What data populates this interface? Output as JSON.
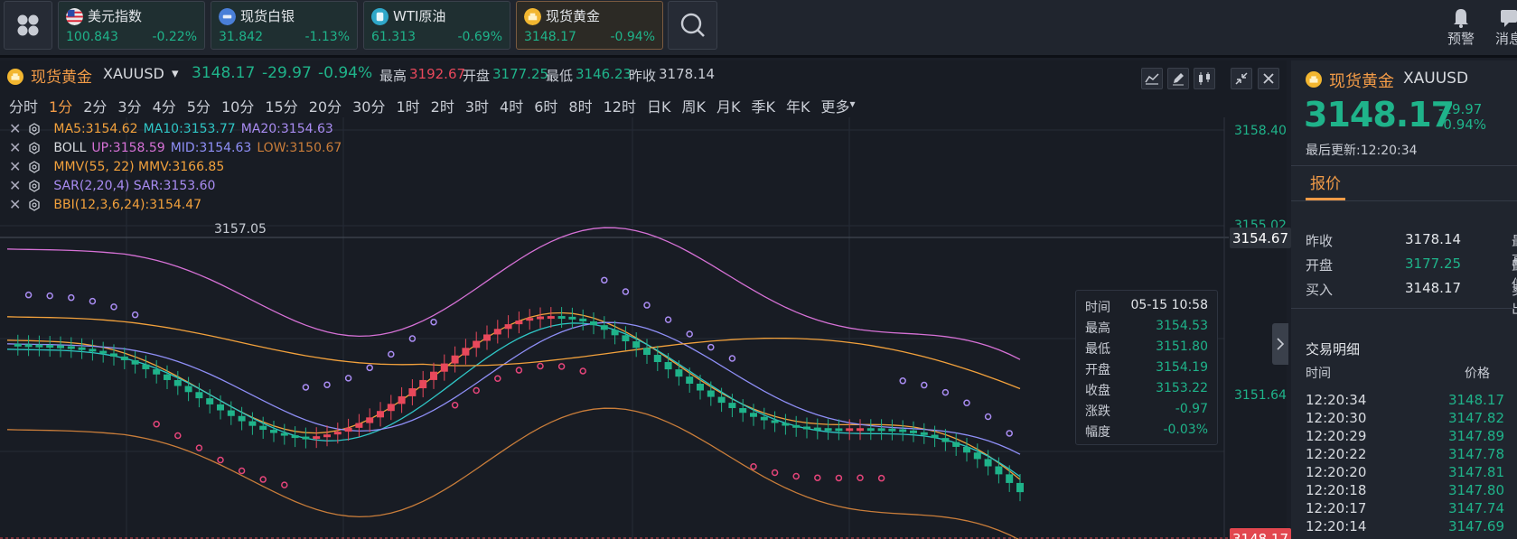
{
  "topbar": {
    "tickers": [
      {
        "name": "美元指数",
        "price": "100.843",
        "change": "-0.22%",
        "icon": "us-flag-icon"
      },
      {
        "name": "现货白银",
        "price": "31.842",
        "change": "-1.13%",
        "icon": "silver-icon"
      },
      {
        "name": "WTI原油",
        "price": "61.313",
        "change": "-0.69%",
        "icon": "oil-icon"
      },
      {
        "name": "现货黄金",
        "price": "3148.17",
        "change": "-0.94%",
        "icon": "gold-icon"
      }
    ],
    "alert_label": "预警",
    "message_label": "消息"
  },
  "chart_header": {
    "name": "现货黄金",
    "symbol": "XAUUSD",
    "price": "3148.17",
    "change": "-29.97",
    "change_pct": "-0.94%",
    "high_label": "最高",
    "high": "3192.67",
    "open_label": "开盘",
    "open": "3177.25",
    "low_label": "最低",
    "low": "3146.23",
    "prev_label": "昨收",
    "prev": "3178.14"
  },
  "periods": [
    "分时",
    "1分",
    "2分",
    "3分",
    "4分",
    "5分",
    "10分",
    "15分",
    "20分",
    "30分",
    "1时",
    "2时",
    "3时",
    "4时",
    "6时",
    "8时",
    "12时",
    "日K",
    "周K",
    "月K",
    "季K",
    "年K",
    "更多"
  ],
  "active_period": "1分",
  "indicators": [
    {
      "segments": [
        {
          "text": "MA5:3154.62",
          "color": "#f2a13c"
        },
        {
          "text": "MA10:3153.77",
          "color": "#2fc6c6"
        },
        {
          "text": "MA20:3154.63",
          "color": "#a98cf2"
        }
      ]
    },
    {
      "segments": [
        {
          "text": "BOLL",
          "color": "#d8dbe0"
        },
        {
          "text": "UP:3158.59",
          "color": "#d671d6"
        },
        {
          "text": "MID:3154.63",
          "color": "#8f8ff7"
        },
        {
          "text": "LOW:3150.67",
          "color": "#c97d3a"
        }
      ]
    },
    {
      "segments": [
        {
          "text": "MMV(55, 22) MMV:3166.85",
          "color": "#f2a13c"
        }
      ]
    },
    {
      "segments": [
        {
          "text": "SAR(2,20,4) SAR:3153.60",
          "color": "#a98cf2"
        }
      ]
    },
    {
      "segments": [
        {
          "text": "BBI(12,3,6,24):3154.47",
          "color": "#f2a13c"
        }
      ]
    }
  ],
  "chart_annotation": "3157.05",
  "y_axis": {
    "ticks": [
      "3158.40",
      "3155.02",
      "3151.64"
    ],
    "crosshair_price": "3154.67",
    "last_price": "3148.17"
  },
  "tooltip": {
    "time_label": "时间",
    "time": "05-15 10:58",
    "rows": [
      {
        "label": "最高",
        "value": "3154.53"
      },
      {
        "label": "最低",
        "value": "3151.80"
      },
      {
        "label": "开盘",
        "value": "3154.19"
      },
      {
        "label": "收盘",
        "value": "3153.22"
      },
      {
        "label": "涨跌",
        "value": "-0.97"
      },
      {
        "label": "幅度",
        "value": "-0.03%"
      }
    ]
  },
  "right_panel": {
    "name": "现货黄金",
    "symbol": "XAUUSD",
    "price": "3148.17",
    "change": "-29.97",
    "change_pct": "-0.94%",
    "updated": "最后更新:12:20:34",
    "tab": "报价",
    "quotes": [
      {
        "label": "昨收",
        "value": "3178.14",
        "label2": "最高"
      },
      {
        "label": "开盘",
        "value": "3177.25",
        "label2": "最低"
      },
      {
        "label": "买入",
        "value": "3148.17",
        "label2": "卖出"
      }
    ],
    "trades_title": "交易明细",
    "trades_col_time": "时间",
    "trades_col_price": "价格",
    "trades": [
      {
        "time": "12:20:34",
        "price": "3148.17"
      },
      {
        "time": "12:20:30",
        "price": "3147.82"
      },
      {
        "time": "12:20:29",
        "price": "3147.89"
      },
      {
        "time": "12:20:22",
        "price": "3147.78"
      },
      {
        "time": "12:20:20",
        "price": "3147.81"
      },
      {
        "time": "12:20:18",
        "price": "3147.80"
      },
      {
        "time": "12:20:17",
        "price": "3147.74"
      },
      {
        "time": "12:20:14",
        "price": "3147.69"
      }
    ]
  },
  "colors": {
    "up": "#e8485b",
    "down": "#1fb38a",
    "accent": "#f29b47",
    "background": "#181c24"
  }
}
